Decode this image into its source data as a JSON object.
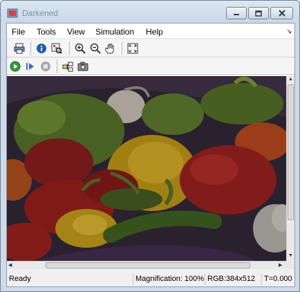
{
  "window": {
    "title": "Darkened"
  },
  "menubar": {
    "items": [
      {
        "label": "File"
      },
      {
        "label": "Tools"
      },
      {
        "label": "View"
      },
      {
        "label": "Simulation"
      },
      {
        "label": "Help"
      }
    ],
    "dock_glyph": "↘"
  },
  "toolbar": {
    "row1": [
      "print-icon",
      "info-icon",
      "pixel-region-icon",
      "zoom-in-icon",
      "zoom-out-icon",
      "pan-hand-icon",
      "fit-to-window-icon"
    ],
    "row2": [
      "play-icon",
      "step-forward-icon",
      "stop-icon",
      "highlight-block-icon",
      "snapshot-camera-icon"
    ]
  },
  "statusbar": {
    "ready": "Ready",
    "magnification": "Magnification: 100%",
    "rgb": "RGB:384x512",
    "time": "T=0.000"
  },
  "image": {
    "content": "darkened peppers image"
  }
}
